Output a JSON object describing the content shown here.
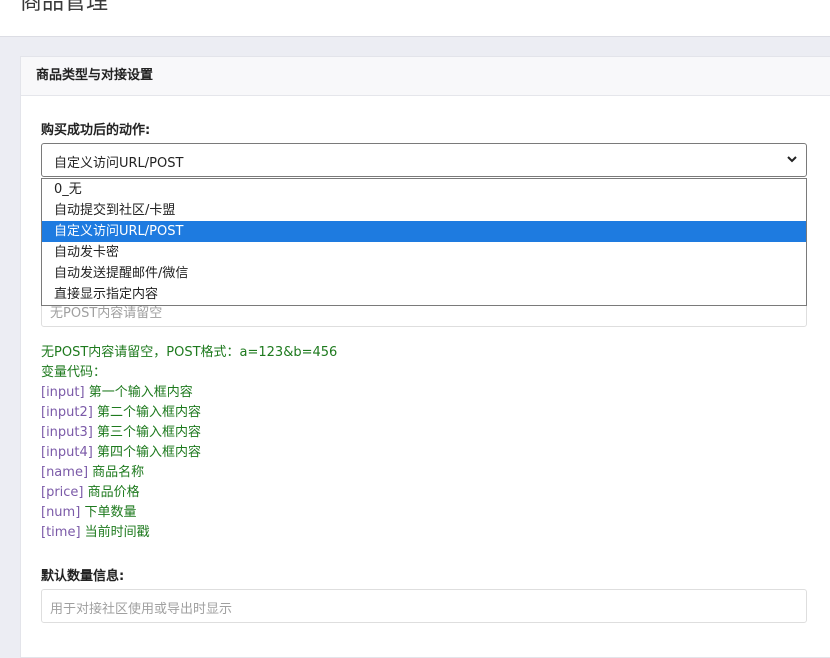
{
  "header": {
    "title": "商品管理"
  },
  "panel": {
    "title": "商品类型与对接设置"
  },
  "action": {
    "label": "购买成功后的动作:",
    "selected": "自定义访问URL/POST",
    "options": [
      "0_无",
      "自动提交到社区/卡盟",
      "自定义访问URL/POST",
      "自动发卡密",
      "自动发送提醒邮件/微信",
      "直接显示指定内容"
    ]
  },
  "post_field": {
    "placeholder": "无POST内容请留空"
  },
  "help": {
    "note": "无POST内容请留空，POST格式：a=123&b=456",
    "vars_title": "变量代码：",
    "vars": [
      {
        "code": "[input]",
        "desc": "第一个输入框内容"
      },
      {
        "code": "[input2]",
        "desc": "第二个输入框内容"
      },
      {
        "code": "[input3]",
        "desc": "第三个输入框内容"
      },
      {
        "code": "[input4]",
        "desc": "第四个输入框内容"
      },
      {
        "code": "[name]",
        "desc": "商品名称"
      },
      {
        "code": "[price]",
        "desc": "商品价格"
      },
      {
        "code": "[num]",
        "desc": "下单数量"
      },
      {
        "code": "[time]",
        "desc": "当前时间戳"
      }
    ]
  },
  "default_qty": {
    "label": "默认数量信息:",
    "placeholder": "用于对接社区使用或导出时显示"
  }
}
